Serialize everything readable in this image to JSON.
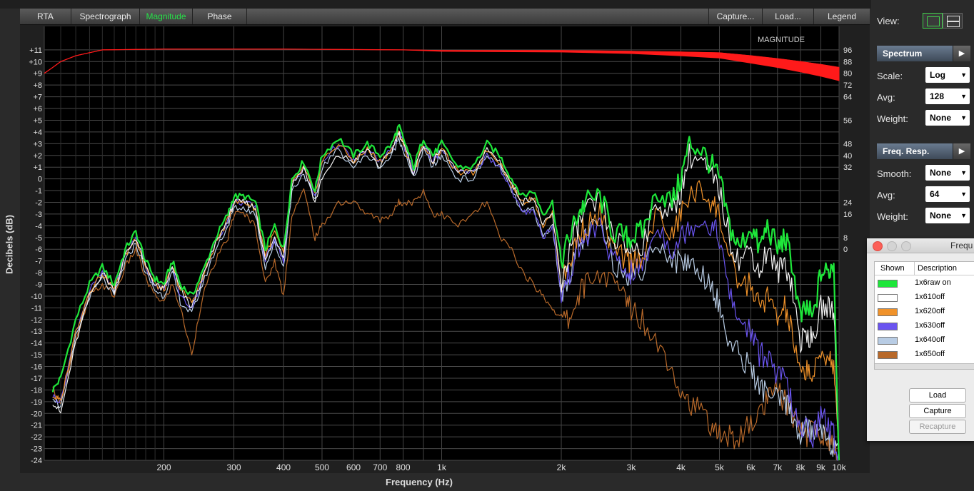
{
  "tabs": [
    "RTA",
    "Spectrograph",
    "Magnitude",
    "Phase"
  ],
  "right_tabs": [
    "Capture...",
    "Load...",
    "Legend"
  ],
  "active_tab": "Magnitude",
  "chart_data": {
    "type": "line",
    "xlabel": "Frequency (Hz)",
    "ylabel": "Decibels (dB)",
    "x_scale": "log",
    "xlim": [
      100,
      10000
    ],
    "ylim": [
      -24,
      12
    ],
    "x_ticks": [
      {
        "v": 200,
        "label": "200"
      },
      {
        "v": 300,
        "label": "300"
      },
      {
        "v": 400,
        "label": "400"
      },
      {
        "v": 500,
        "label": "500"
      },
      {
        "v": 600,
        "label": "600"
      },
      {
        "v": 700,
        "label": "700"
      },
      {
        "v": 800,
        "label": "800"
      },
      {
        "v": 1000,
        "label": "1k"
      },
      {
        "v": 2000,
        "label": "2k"
      },
      {
        "v": 3000,
        "label": "3k"
      },
      {
        "v": 4000,
        "label": "4k"
      },
      {
        "v": 5000,
        "label": "5k"
      },
      {
        "v": 6000,
        "label": "6k"
      },
      {
        "v": 7000,
        "label": "7k"
      },
      {
        "v": 8000,
        "label": "8k"
      },
      {
        "v": 9000,
        "label": "9k"
      },
      {
        "v": 10000,
        "label": "10k"
      }
    ],
    "y_ticks": [
      11,
      10,
      9,
      8,
      7,
      6,
      5,
      4,
      3,
      2,
      1,
      0,
      -1,
      -2,
      -3,
      -4,
      -5,
      -6,
      -7,
      -8,
      -9,
      -10,
      -11,
      -12,
      -13,
      -14,
      -15,
      -16,
      -17,
      -18,
      -19,
      -20,
      -21,
      -22,
      -23,
      -24
    ],
    "y2_ticks": [
      {
        "v": 96,
        "at": 11
      },
      {
        "v": 88,
        "at": 10
      },
      {
        "v": 80,
        "at": 9
      },
      {
        "v": 72,
        "at": 8
      },
      {
        "v": 64,
        "at": 7
      },
      {
        "v": 56,
        "at": 5
      },
      {
        "v": 48,
        "at": 3
      },
      {
        "v": 40,
        "at": 2
      },
      {
        "v": 32,
        "at": 1
      },
      {
        "v": 24,
        "at": -2
      },
      {
        "v": 16,
        "at": -3
      },
      {
        "v": 8,
        "at": -5
      },
      {
        "v": 0,
        "at": -6
      }
    ],
    "annotation": "MAGNITUDE",
    "grid": true,
    "series": [
      {
        "name": "1x6raw on",
        "color": "#1ee63a",
        "x": [
          105,
          110,
          120,
          130,
          140,
          150,
          160,
          170,
          180,
          190,
          200,
          210,
          220,
          235,
          250,
          270,
          290,
          300,
          320,
          340,
          360,
          380,
          400,
          420,
          450,
          480,
          500,
          550,
          600,
          650,
          700,
          750,
          780,
          800,
          850,
          900,
          950,
          1000,
          1100,
          1200,
          1300,
          1400,
          1500,
          1600,
          1700,
          1800,
          1900,
          2000,
          2100,
          2200,
          2300,
          2500,
          2700,
          2900,
          3000,
          3200,
          3500,
          3800,
          4000,
          4200,
          4500,
          4800,
          5000,
          5300,
          5600,
          6000,
          6300,
          6600,
          7000,
          7300,
          7600,
          8000,
          8300,
          8600,
          9000,
          9400,
          9700,
          10000
        ],
        "y": [
          -18,
          -17,
          -12,
          -9,
          -7.5,
          -9,
          -6,
          -4.5,
          -7,
          -8.5,
          -9,
          -7,
          -9,
          -10,
          -8,
          -5,
          -3,
          -1.5,
          -1.5,
          -2,
          -6,
          -4,
          -6,
          0,
          1.5,
          -1,
          2,
          3.5,
          2,
          3,
          2,
          3,
          4.5,
          3.5,
          1,
          3.5,
          2,
          3,
          1,
          1,
          3,
          2,
          0,
          -1.5,
          -1,
          -3,
          -2,
          -7,
          -5,
          -3,
          -2,
          -1.5,
          -4.5,
          -5,
          -5,
          -4.5,
          -1,
          -2,
          0,
          3,
          2.5,
          1,
          0,
          -4,
          -6,
          -4,
          -6,
          -4,
          -6,
          -5,
          -7,
          -12,
          -11,
          -12,
          -8,
          -8,
          -7,
          -24
        ]
      },
      {
        "name": "1x610off",
        "color": "#f2f2f2",
        "x": [
          105,
          110,
          120,
          130,
          140,
          150,
          160,
          170,
          180,
          190,
          200,
          210,
          220,
          235,
          250,
          270,
          290,
          300,
          320,
          340,
          360,
          380,
          400,
          420,
          450,
          480,
          500,
          550,
          600,
          650,
          700,
          750,
          780,
          800,
          850,
          900,
          950,
          1000,
          1100,
          1200,
          1300,
          1400,
          1500,
          1600,
          1700,
          1800,
          1900,
          2000,
          2100,
          2200,
          2300,
          2500,
          2700,
          2900,
          3000,
          3200,
          3500,
          3800,
          4000,
          4200,
          4500,
          4800,
          5000,
          5300,
          5600,
          6000,
          6300,
          6600,
          7000,
          7300,
          7600,
          8000,
          8300,
          8600,
          9000,
          9400,
          9700,
          10000
        ],
        "y": [
          -19,
          -20,
          -14,
          -10,
          -8,
          -9.5,
          -6.5,
          -5,
          -7.5,
          -9,
          -9.5,
          -7.5,
          -9.5,
          -11,
          -8.5,
          -5.5,
          -3.5,
          -2,
          -2,
          -2.5,
          -7,
          -5,
          -6.5,
          -0.5,
          1,
          -2,
          0,
          2,
          1.5,
          2.5,
          1,
          2.5,
          4,
          3,
          0.5,
          3,
          1.5,
          2.5,
          0.5,
          0.5,
          2.5,
          1.5,
          -0.5,
          -2,
          -1.5,
          -4,
          -3,
          -9,
          -6,
          -4,
          -3,
          -2,
          -5,
          -6,
          -6,
          -5.5,
          -2,
          -3,
          -1,
          2,
          1.5,
          0,
          -1,
          -5,
          -7,
          -6,
          -8,
          -6,
          -8,
          -7,
          -9,
          -14,
          -13,
          -14,
          -11,
          -11,
          -11,
          -24
        ]
      },
      {
        "name": "1x620off",
        "color": "#f0922a",
        "x": [
          105,
          110,
          120,
          130,
          140,
          150,
          160,
          170,
          180,
          190,
          200,
          210,
          220,
          235,
          250,
          270,
          290,
          300,
          320,
          340,
          360,
          380,
          400,
          420,
          450,
          480,
          500,
          550,
          600,
          650,
          700,
          750,
          780,
          800,
          850,
          900,
          950,
          1000,
          1100,
          1200,
          1300,
          1400,
          1500,
          1600,
          1700,
          1800,
          1900,
          2000,
          2100,
          2200,
          2300,
          2500,
          2700,
          2900,
          3000,
          3200,
          3500,
          3800,
          4000,
          4200,
          4500,
          4800,
          5000,
          5300,
          5600,
          6000,
          6300,
          6600,
          7000,
          7300,
          7600,
          8000,
          8300,
          8600,
          9000,
          9400,
          9700,
          10000
        ],
        "y": [
          -18.5,
          -19,
          -13,
          -9.5,
          -8,
          -9.5,
          -6.5,
          -5,
          -7.5,
          -9,
          -9.5,
          -7.5,
          -9.5,
          -10.5,
          -8.5,
          -5.5,
          -3.5,
          -2,
          -2,
          -2.5,
          -6.5,
          -4.5,
          -6.5,
          -0.5,
          1,
          -1.5,
          1.5,
          3,
          1.5,
          2.5,
          1.5,
          2.5,
          4,
          3,
          0.5,
          3,
          1.5,
          2.5,
          0.5,
          0.5,
          2.5,
          1.5,
          -0.5,
          -2,
          -1.5,
          -4,
          -3,
          -9,
          -7,
          -5,
          -4,
          -3,
          -6,
          -7,
          -7,
          -6.5,
          -3,
          -5,
          -3,
          -1.5,
          -1,
          -2,
          -3,
          -7,
          -9,
          -9,
          -11,
          -10,
          -12,
          -11,
          -13,
          -17,
          -16,
          -17,
          -15,
          -15,
          -16,
          -24
        ]
      },
      {
        "name": "1x630off",
        "color": "#6a54f0",
        "x": [
          105,
          110,
          120,
          130,
          140,
          150,
          160,
          170,
          180,
          190,
          200,
          210,
          220,
          235,
          250,
          270,
          290,
          300,
          320,
          340,
          360,
          380,
          400,
          420,
          450,
          480,
          500,
          550,
          600,
          650,
          700,
          750,
          780,
          800,
          850,
          900,
          950,
          1000,
          1100,
          1200,
          1300,
          1400,
          1500,
          1600,
          1700,
          1800,
          1900,
          2000,
          2100,
          2200,
          2300,
          2500,
          2700,
          2900,
          3000,
          3200,
          3500,
          3800,
          4000,
          4200,
          4500,
          4800,
          5000,
          5300,
          5600,
          6000,
          6300,
          6600,
          7000,
          7300,
          7600,
          8000,
          8300,
          8600,
          9000,
          9400,
          9700,
          10000
        ],
        "y": [
          -18.5,
          -19,
          -13,
          -9.5,
          -8,
          -9.5,
          -6.5,
          -5,
          -7.5,
          -9,
          -9.5,
          -7.5,
          -10,
          -11,
          -8.5,
          -5.5,
          -3.5,
          -2,
          -2,
          -2.5,
          -7,
          -5,
          -7,
          -0.5,
          1,
          -1.5,
          1.5,
          3,
          1.5,
          2.5,
          1.5,
          2.5,
          4,
          3,
          0.5,
          3,
          1.5,
          2.5,
          0.5,
          0.5,
          2,
          1,
          -1,
          -3,
          -2.5,
          -5,
          -4,
          -10,
          -8,
          -6,
          -5,
          -4,
          -7,
          -8,
          -8,
          -7.5,
          -4,
          -6,
          -5,
          -4,
          -3.5,
          -4,
          -5,
          -10,
          -12,
          -13,
          -15,
          -15,
          -17,
          -17,
          -19,
          -22,
          -21,
          -22,
          -20,
          -21,
          -22,
          -24
        ]
      },
      {
        "name": "1x640off",
        "color": "#b8cce4",
        "x": [
          105,
          110,
          120,
          130,
          140,
          150,
          160,
          170,
          180,
          190,
          200,
          210,
          220,
          235,
          250,
          270,
          290,
          300,
          320,
          340,
          360,
          380,
          400,
          420,
          450,
          480,
          500,
          550,
          600,
          650,
          700,
          750,
          780,
          800,
          850,
          900,
          950,
          1000,
          1100,
          1200,
          1300,
          1400,
          1500,
          1600,
          1700,
          1800,
          1900,
          2000,
          2100,
          2200,
          2300,
          2500,
          2700,
          2900,
          3000,
          3200,
          3500,
          3800,
          4000,
          4200,
          4500,
          4800,
          5000,
          5300,
          5600,
          6000,
          6300,
          6600,
          7000,
          7300,
          7600,
          8000,
          8300,
          8600,
          9000,
          9400,
          9700,
          10000
        ],
        "y": [
          -18.5,
          -19.5,
          -13.5,
          -10,
          -8.5,
          -10,
          -7,
          -5.5,
          -8,
          -9.5,
          -10,
          -8,
          -10.5,
          -11.5,
          -9,
          -6,
          -4,
          -2.5,
          -2.5,
          -3,
          -7.5,
          -5.5,
          -7.5,
          -1,
          0.5,
          -2,
          1,
          2.5,
          1,
          2,
          1,
          2,
          3.5,
          2.5,
          0,
          2.5,
          1,
          2,
          0,
          0,
          2,
          1,
          -1,
          -3,
          -2.5,
          -5,
          -4,
          -10,
          -8,
          -6,
          -5,
          -4,
          -7,
          -8,
          -8,
          -8,
          -5,
          -7,
          -7,
          -7,
          -8,
          -9,
          -11,
          -14,
          -15,
          -16,
          -18,
          -18,
          -19,
          -19,
          -20,
          -22,
          -21,
          -22,
          -21,
          -22,
          -23,
          -24
        ]
      },
      {
        "name": "1x650off",
        "color": "#b8692a",
        "x": [
          105,
          110,
          120,
          130,
          140,
          150,
          160,
          170,
          180,
          190,
          200,
          210,
          220,
          235,
          250,
          270,
          290,
          300,
          320,
          340,
          360,
          380,
          400,
          420,
          450,
          480,
          500,
          550,
          600,
          650,
          700,
          750,
          780,
          800,
          850,
          900,
          950,
          1000,
          1100,
          1200,
          1300,
          1400,
          1500,
          1600,
          1700,
          1800,
          1900,
          2000,
          2100,
          2200,
          2300,
          2500,
          2700,
          2900,
          3000,
          3200,
          3500,
          3800,
          4000,
          4200,
          4500,
          4800,
          5000,
          5300,
          5600,
          6000,
          6300,
          6600,
          7000,
          7300,
          7600,
          8000,
          8300,
          8600,
          9000,
          9400,
          9700,
          10000
        ],
        "y": [
          -18,
          -19,
          -14,
          -10,
          -9,
          -10,
          -7.5,
          -6,
          -8.5,
          -10,
          -10.5,
          -9,
          -11,
          -15,
          -10,
          -7,
          -5,
          -3,
          -3,
          -4,
          -9,
          -7,
          -10,
          -3,
          -1,
          -5,
          -4,
          -2,
          -2,
          -3,
          -3.5,
          -3,
          -2,
          -2,
          -2,
          -1,
          -3,
          -3,
          -4,
          -3,
          -2,
          -5,
          -6,
          -8,
          -9,
          -10,
          -11,
          -12,
          -12,
          -10,
          -9,
          -8,
          -9,
          -10,
          -11,
          -12,
          -14,
          -16,
          -18,
          -19,
          -20,
          -21,
          -22,
          -22,
          -22,
          -21,
          -20,
          -19,
          -18,
          -19,
          -20,
          -21,
          -22,
          -21,
          -22,
          -22,
          -23,
          -24
        ]
      }
    ],
    "reference_curve": {
      "color": "#ff1a1a",
      "x": [
        100,
        105,
        110,
        120,
        140,
        200,
        400,
        800,
        1000,
        2000,
        3000,
        4000,
        5000,
        6000,
        7000,
        8000,
        9000,
        10000
      ],
      "y2": [
        80,
        84,
        88,
        92,
        96,
        96.5,
        96.5,
        96,
        95.5,
        95.5,
        95,
        94.5,
        94,
        92,
        90,
        88,
        86,
        84
      ],
      "band": [
        0,
        0,
        0,
        0,
        0,
        0,
        0,
        0,
        0.5,
        1,
        1.5,
        2.5,
        3.5,
        5,
        6,
        7,
        8,
        9
      ]
    }
  },
  "side_panel": {
    "view_label": "View:",
    "spectrum_header": "Spectrum",
    "scale_label": "Scale:",
    "scale_value": "Log",
    "avg_label": "Avg:",
    "avg_value": "128",
    "weight_label": "Weight:",
    "weight_value": "None",
    "freq_header": "Freq. Resp.",
    "smooth_label": "Smooth:",
    "smooth_value": "None",
    "favg_label": "Avg:",
    "favg_value": "64",
    "fweight_label": "Weight:",
    "fweight_value": "None"
  },
  "legend_window": {
    "title": "Frequ",
    "col_shown": "Shown",
    "col_description": "Description",
    "rows": [
      {
        "desc": "1x6raw on",
        "color": "#1ee63a"
      },
      {
        "desc": "1x610off",
        "color": "#ffffff"
      },
      {
        "desc": "1x620off",
        "color": "#f0922a"
      },
      {
        "desc": "1x630off",
        "color": "#6a54f0"
      },
      {
        "desc": "1x640off",
        "color": "#b8cce4"
      },
      {
        "desc": "1x650off",
        "color": "#b8692a"
      }
    ],
    "load_label": "Load",
    "capture_label": "Capture",
    "recapture_label": "Recapture"
  }
}
